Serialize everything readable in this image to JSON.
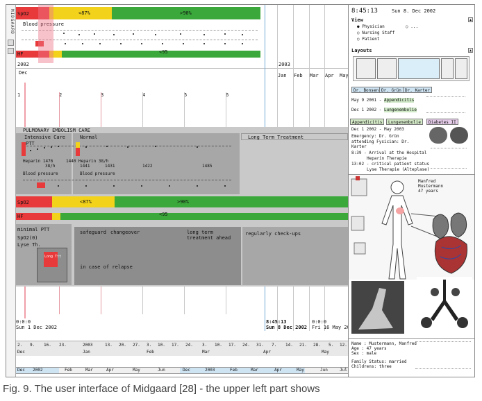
{
  "app": {
    "vertical_title": "MIDGAARD"
  },
  "top_chart": {
    "spo2_label": "SpO2",
    "spo2_low": "<87%",
    "spo2_high": ">90%",
    "blood_pressure_label": "Blood pressure",
    "hf_label": "HF",
    "hf_value": "<95",
    "colors": {
      "green": "#3aa83a",
      "yellow": "#f2d21b",
      "red": "#e83a3a"
    }
  },
  "overview_timeline": {
    "year_left": "2002",
    "year_right": "2003",
    "months": [
      "Jan",
      "Feb",
      "Mar",
      "Apr",
      "May"
    ],
    "start_day": "Dec",
    "day_markers": [
      "1",
      "2",
      "3",
      "4",
      "5",
      "6"
    ]
  },
  "treatment": {
    "header": "PULMONARY EMBOLISM CARE",
    "intensive_care": "Intensive Care",
    "normal": "Normal",
    "long_term": "Long Term Treatment",
    "ptt_label": "PTT",
    "heparin_left": "Heparin 1476",
    "heparin_right": "Heparin 38/h",
    "val_1440": "1440",
    "val_1431": "1431",
    "val_1422": "1422",
    "val_1485": "1485",
    "val_1441": "1441",
    "val_38h": "38/h",
    "bp_left": "Blood pressure",
    "bp_right": "Blood pressure",
    "spo2_label": "SpO2",
    "spo2_low": "<87%",
    "spo2_high": ">90%",
    "hf_label": "HF",
    "hf_value": "<95",
    "minimal_ptt": "minimal PTT",
    "safeguard": "safeguard",
    "changeover": "changeover",
    "long_term_treatment": "long term treatment ahead",
    "regularly": "regularly check-ups",
    "spo2_cond": "SpO2(0)",
    "lyse": "Lyse Th.",
    "relapse": "in case of relapse",
    "small_bar": "Long Ttt"
  },
  "time_readouts": {
    "left_time": "0:0:0",
    "left_date": "Sun 1 Dec 2002",
    "cursor_time": "8:45:13",
    "cursor_date": "Sun 8 Dec 2002",
    "right_time": "0:0:0",
    "right_date": "Fri 16 May 2003"
  },
  "bottom_axis": {
    "ticks": [
      "2.",
      "9.",
      "16.",
      "23.",
      "2003",
      "13.",
      "20.",
      "27.",
      "3.",
      "10.",
      "17.",
      "24.",
      "3.",
      "10.",
      "17.",
      "24.",
      "31.",
      "7.",
      "14.",
      "21.",
      "28.",
      "5.",
      "12."
    ],
    "months": [
      "Dec",
      "Jan",
      "Feb",
      "Mar",
      "Apr",
      "May"
    ]
  },
  "navigator": {
    "cells": [
      "Dec",
      "2002",
      "Feb",
      "Mar",
      "Apr",
      "May",
      "Jun",
      "Dec",
      "2003",
      "Feb",
      "Mar",
      "Apr",
      "May",
      "Jun",
      "Jul"
    ]
  },
  "right_panel": {
    "clock": "8:45:13",
    "date": "Sun 8. Dec 2002",
    "view_label": "View",
    "view_options": [
      "Physician",
      "Nursing Staff",
      "Patient"
    ],
    "view_extra": "...",
    "layouts_label": "Layouts",
    "doctor_tabs": [
      "Dr. Bonsen",
      "Dr. Grün",
      "Dr. Karter"
    ],
    "history": [
      {
        "date": "May 9 2001",
        "sep": "-",
        "diag": "Appendicitis"
      },
      {
        "date": "Dec 1 2002",
        "sep": "-",
        "diag": "Lungenembolie"
      }
    ],
    "diag_tabs": [
      "Appendicitis",
      "Lungenembolie",
      "Diabetes II"
    ],
    "current_case": "Dec 1 2002 - May 2003",
    "emergency": "Emergency: Dr. Grün",
    "attending": "attending Fysician: Dr. Karter",
    "events": [
      {
        "time": "8:39",
        "text": "- Arrival at the Hospital"
      },
      {
        "time": "",
        "text": "Heparin Therapie"
      },
      {
        "time": "13:02",
        "text": "- critical patient status"
      },
      {
        "time": "",
        "text": "Lyse Therapie (Alteplase)"
      }
    ],
    "patient_name": "Manfred",
    "patient_surname": "Mustermann",
    "patient_age": "47 years",
    "info_lines": [
      "Name : Mustermann, Manfred",
      "Age : 47 years",
      "Sex : male",
      "Family Status: married",
      "Childrens: three"
    ]
  },
  "caption": "Fig. 9. The user interface of Midgaard [28] - the upper left part shows"
}
